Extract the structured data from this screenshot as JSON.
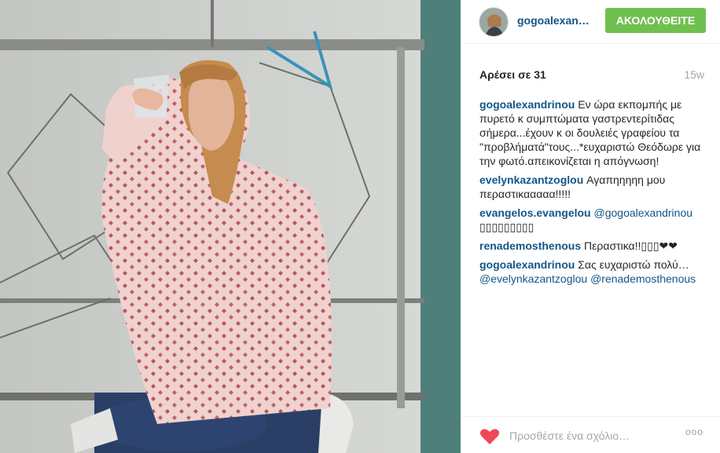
{
  "post": {
    "username": "gogoalexan…",
    "follow_label": "ΑΚΟΛΟΥΘΕΙΤΕ",
    "likes": "Αρέσει σε 31",
    "timestamp": "15w"
  },
  "comments": [
    {
      "user": "gogoalexandrinou",
      "text": " Εν ώρα εκπομπής με πυρετό κ συμπτώματα γαστρεντερίτιδας σήμερα...έχουν κ οι δουλειές γραφείου τα \"προβλήματά\"τους...*ευχαριστώ Θεόδωρε για την φωτό.απεικονίζεται η απόγνωση!"
    },
    {
      "user": "evelynkazantzoglou",
      "text": " Αγαπηηηηη μου περαστικααααα!!!!!"
    },
    {
      "user": "evangelos.evangelou",
      "mention": " @gogoalexandrinou",
      "text": " ▯▯▯▯▯▯▯▯▯"
    },
    {
      "user": "renademosthenous",
      "text": " Περαστικα!!▯▯▯❤❤"
    },
    {
      "user": "gogoalexandrinou",
      "text": " Σας ευχαριστώ πολύ…",
      "mention2": "@evelynkazantzoglou @renademosthenous"
    }
  ],
  "footer": {
    "comment_placeholder": "Προσθέστε ένα σχόλιο…",
    "more_label": "ooo"
  },
  "icons": {
    "like": "heart-icon",
    "more": "more-options-icon"
  },
  "colors": {
    "follow": "#70c050",
    "username": "#125688",
    "heart": "#ed4956"
  }
}
